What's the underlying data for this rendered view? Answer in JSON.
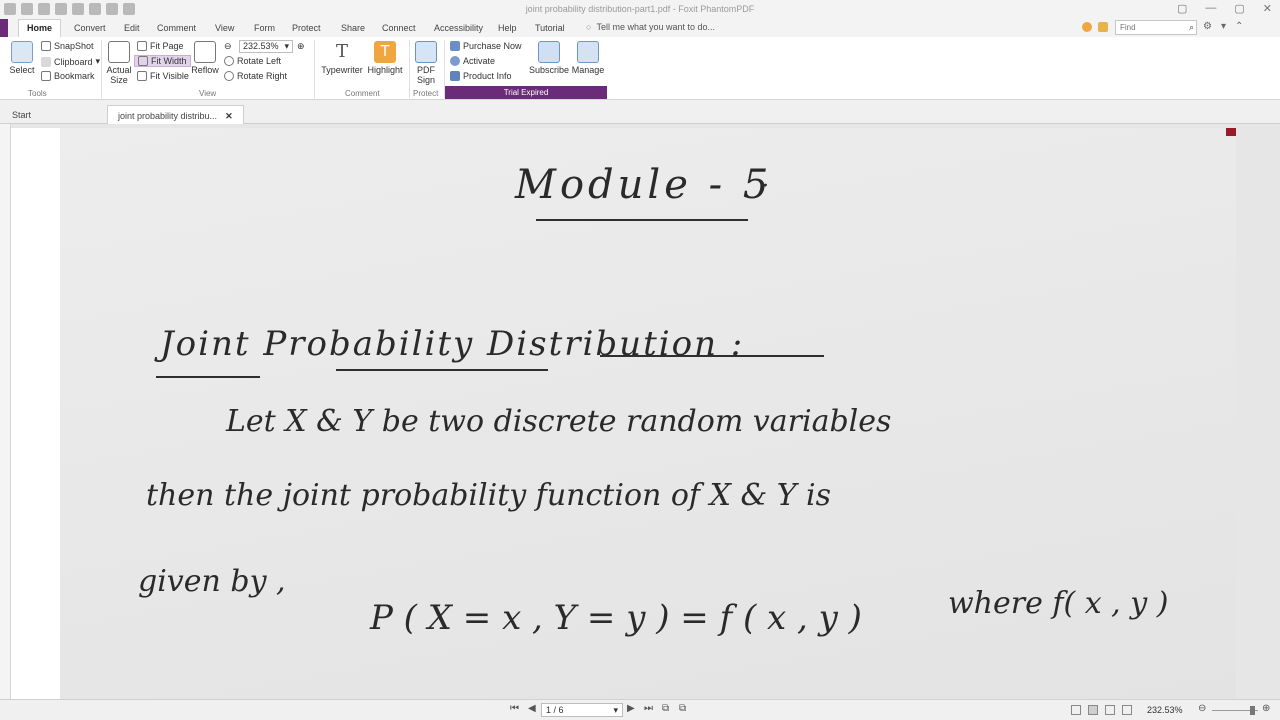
{
  "window": {
    "title": "joint probability distribution-part1.pdf - Foxit PhantomPDF",
    "controls": [
      "▢",
      "—",
      "▢",
      "✕"
    ]
  },
  "menu": {
    "tabs": [
      "Home",
      "Convert",
      "Edit",
      "Comment",
      "View",
      "Form",
      "Protect",
      "Share",
      "Connect",
      "Accessibility",
      "Help",
      "Tutorial"
    ],
    "tell_me": "Tell me what you want to do...",
    "find_placeholder": "Find"
  },
  "ribbon": {
    "select": "Select",
    "snapshot": "SnapShot",
    "clipboard": "Clipboard",
    "bookmark": "Bookmark",
    "tools_group": "Tools",
    "actual_size": "Actual Size",
    "fit_page": "Fit Page",
    "fit_width": "Fit Width",
    "fit_visible": "Fit Visible",
    "reflow": "Reflow",
    "zoom": "232.53%",
    "rotate_left": "Rotate Left",
    "rotate_right": "Rotate Right",
    "view_group": "View",
    "typewriter": "Typewriter",
    "highlight": "Highlight",
    "comment_group": "Comment",
    "pdf_sign": "PDF Sign",
    "protect_group": "Protect",
    "purchase_now": "Purchase Now",
    "activate": "Activate",
    "product_info": "Product Info",
    "subscribe": "Subscribe",
    "manage": "Manage",
    "trial_expired": "Trial Expired"
  },
  "tabs": {
    "start": "Start",
    "document": "joint probability distribu...",
    "close": "✕"
  },
  "document": {
    "heading": "Module - 5",
    "heading_dot": "·",
    "subheading": "Joint  Probability  Distribution :",
    "line1": "Let   X & Y   be   two   discrete   random   variables",
    "line2": "then  the  joint  probability  function  of  X & Y  is",
    "line3": "given  by ,",
    "formula": "P ( X = x ,  Y = y )  =  f ( x , y )",
    "line3_end": "where  f( x , y )"
  },
  "status": {
    "page_indicator": "1 / 6",
    "zoom": "232.53%"
  },
  "colors": {
    "accent": "#6b2b78",
    "highlight_icon": "#f0a640"
  }
}
